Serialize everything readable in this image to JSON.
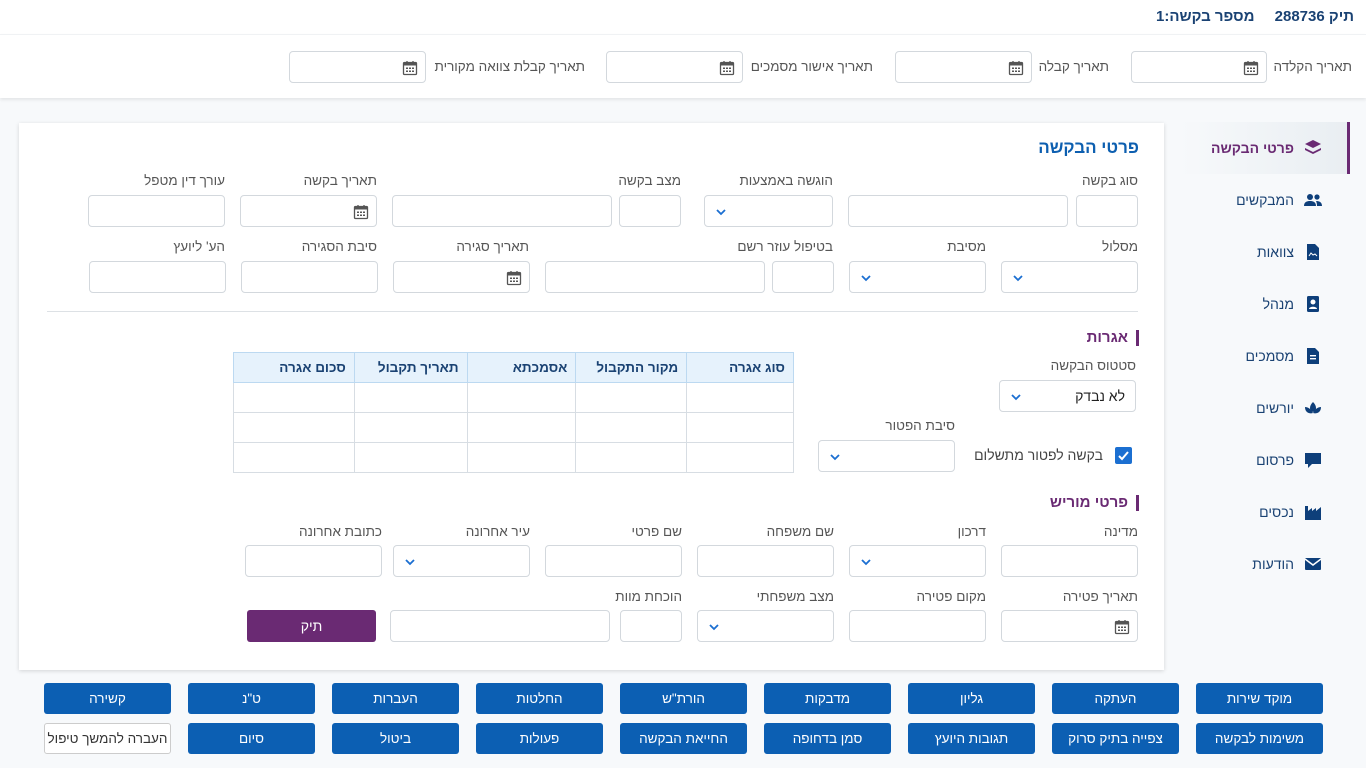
{
  "header": {
    "file_label": "תיק 288736",
    "request_label": "מספר בקשה:1"
  },
  "date_bar": {
    "typing_date": "תאריך הקלדה",
    "receipt_date": "תאריך קבלה",
    "docs_approval_date": "תאריך אישור מסמכים",
    "original_will_date": "תאריך קבלת צוואה מקורית"
  },
  "request_details": {
    "title": "פרטי הבקשה",
    "labels": {
      "request_type": "סוג בקשה",
      "submitted_via": "הוגשה באמצעות",
      "request_state": "מצב בקשה",
      "request_date": "תאריך בקשה",
      "handling_lawyer": "עורך דין מטפל",
      "track": "מסלול",
      "reason": "מסיבת",
      "registrar_assistant": "בטיפול עוזר רשם",
      "closing_date": "תאריך סגירה",
      "closing_reason": "סיבת הסגירה",
      "advisor_note": "הע' ליועץ"
    }
  },
  "fees": {
    "title": "אגרות",
    "request_status_label": "סטטוס הבקשה",
    "request_status_value": "לא נבדק",
    "exemption_reason_label": "סיבת הפטור",
    "exemption_checkbox_label": "בקשה לפטור מתשלום",
    "exemption_checked": true,
    "table": {
      "columns": [
        "סוג אגרה",
        "מקור התקבול",
        "אסמכתא",
        "תאריך תקבול",
        "סכום אגרה"
      ],
      "rows": [
        [
          "",
          "",
          "",
          "",
          ""
        ],
        [
          "",
          "",
          "",
          "",
          ""
        ],
        [
          "",
          "",
          "",
          "",
          ""
        ]
      ]
    }
  },
  "deceased": {
    "title": "פרטי מוריש",
    "labels": {
      "country": "מדינה",
      "passport": "דרכון",
      "last_name": "שם משפחה",
      "first_name": "שם פרטי",
      "last_city": "עיר אחרונה",
      "last_address": "כתובת אחרונה",
      "death_date": "תאריך פטירה",
      "death_place": "מקום פטירה",
      "marital_status": "מצב משפחתי",
      "death_proof": "הוכחת מוות"
    },
    "file_button": "תיק"
  },
  "sidebar": {
    "items": [
      {
        "label": "פרטי הבקשה",
        "icon": "layers-icon",
        "active": true
      },
      {
        "label": "המבקשים",
        "icon": "users-icon"
      },
      {
        "label": "צוואות",
        "icon": "signed-document-icon"
      },
      {
        "label": "מנהל",
        "icon": "id-badge-icon"
      },
      {
        "label": "מסמכים",
        "icon": "document-icon"
      },
      {
        "label": "יורשים",
        "icon": "lotus-icon"
      },
      {
        "label": "פרסום",
        "icon": "comment-icon"
      },
      {
        "label": "נכסים",
        "icon": "industry-icon"
      },
      {
        "label": "הודעות",
        "icon": "envelope-icon"
      }
    ]
  },
  "actions": {
    "row1": [
      "מוקד שירות",
      "העתקה",
      "גליון",
      "מדבקות",
      "הורת\"ש",
      "החלטות",
      "העברות",
      "ט\"נ",
      "קשירה"
    ],
    "row2": [
      "משימות לבקשה",
      "צפייה בתיק סרוק",
      "תגובות היועץ",
      "סמן בדחופה",
      "החייאת הבקשה",
      "פעולות",
      "ביטול",
      "סיום",
      "העברה להמשך טיפול"
    ]
  },
  "colors": {
    "primary": "#0c5fb3",
    "accent": "#6a2a73",
    "title": "#0d5fb0"
  }
}
